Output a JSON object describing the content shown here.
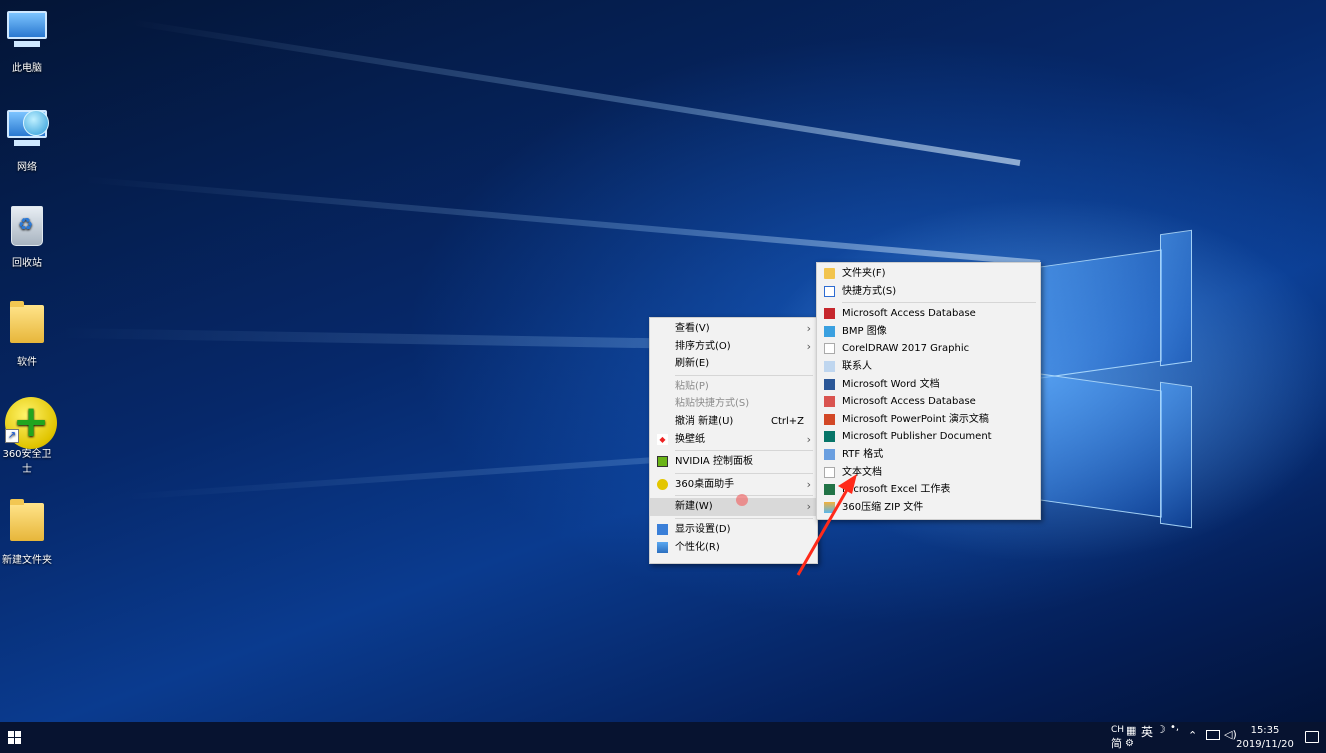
{
  "desktop": {
    "icons": [
      {
        "label": "此电脑",
        "icon": "this-pc-icon"
      },
      {
        "label": "网络",
        "icon": "network-icon"
      },
      {
        "label": "回收站",
        "icon": "recycle-bin-icon"
      },
      {
        "label": "软件",
        "icon": "folder-icon"
      },
      {
        "label": "360安全卫士",
        "icon": "360-security-icon"
      },
      {
        "label": "新建文件夹",
        "icon": "folder-icon"
      }
    ]
  },
  "context_menu": {
    "items": [
      {
        "label": "查看(V)",
        "has_submenu": true
      },
      {
        "label": "排序方式(O)",
        "has_submenu": true
      },
      {
        "label": "刷新(E)"
      },
      {
        "label": "粘贴(P)",
        "disabled": true
      },
      {
        "label": "粘贴快捷方式(S)",
        "disabled": true
      },
      {
        "label": "撤消 新建(U)",
        "shortcut": "Ctrl+Z"
      },
      {
        "label": "换壁纸",
        "has_submenu": true
      },
      {
        "label": "NVIDIA 控制面板"
      },
      {
        "label": "360桌面助手",
        "has_submenu": true
      },
      {
        "label": "新建(W)",
        "has_submenu": true,
        "highlighted": true
      },
      {
        "label": "显示设置(D)"
      },
      {
        "label": "个性化(R)"
      }
    ]
  },
  "new_submenu": {
    "items": [
      {
        "label": "文件夹(F)"
      },
      {
        "label": "快捷方式(S)"
      },
      {
        "label": "Microsoft Access Database"
      },
      {
        "label": "BMP 图像"
      },
      {
        "label": "CorelDRAW 2017 Graphic"
      },
      {
        "label": "联系人"
      },
      {
        "label": "Microsoft Word 文档"
      },
      {
        "label": "Microsoft Access Database"
      },
      {
        "label": "Microsoft PowerPoint 演示文稿"
      },
      {
        "label": "Microsoft Publisher Document"
      },
      {
        "label": "RTF 格式"
      },
      {
        "label": "文本文档"
      },
      {
        "label": "Microsoft Excel 工作表"
      },
      {
        "label": "360压缩 ZIP 文件"
      }
    ]
  },
  "taskbar": {
    "ime_top": "CH",
    "ime_bottom": "简",
    "ime_lang": "英",
    "time": "15:35",
    "date": "2019/11/20"
  },
  "colors": {
    "annotation_arrow": "#ff2a1a",
    "taskbar": "#071330"
  }
}
